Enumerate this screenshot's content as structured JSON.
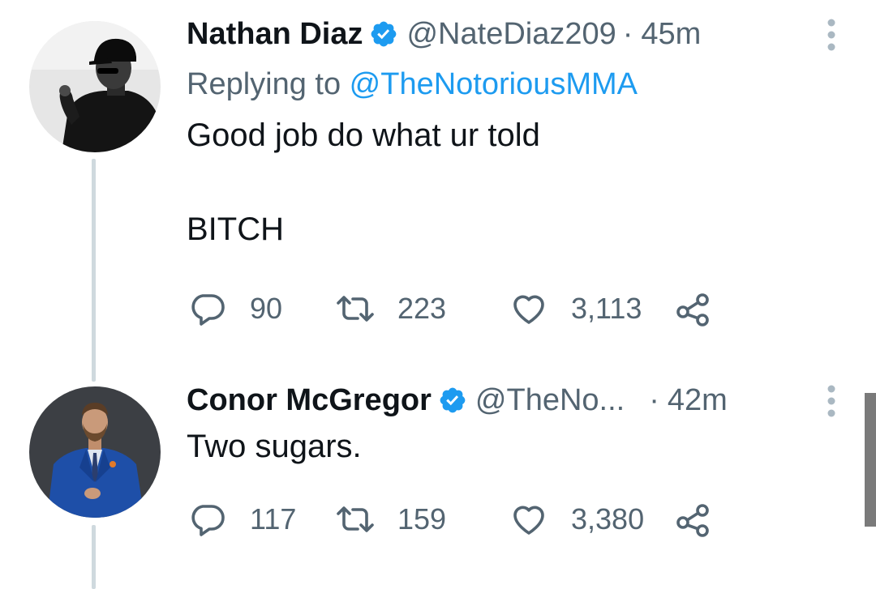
{
  "tweets": [
    {
      "name": "Nathan Diaz",
      "handle": "@NateDiaz209",
      "separator": "·",
      "time": "45m",
      "replying_prefix": "Replying to ",
      "replying_to": "@TheNotoriousMMA",
      "text": "Good job do what ur told\n\nBITCH",
      "replies": "90",
      "retweets": "223",
      "likes": "3,113"
    },
    {
      "name": "Conor McGregor",
      "handle": "@TheNo...",
      "separator": "·",
      "time": "42m",
      "text": "Two sugars.",
      "replies": "117",
      "retweets": "159",
      "likes": "3,380"
    }
  ],
  "colors": {
    "verified": "#1d9bf0",
    "mention": "#1d9bf0",
    "secondary_text": "#536471",
    "thread_line": "#cfd9de"
  },
  "icons": [
    "verified-badge-icon",
    "more-icon",
    "reply-icon",
    "retweet-icon",
    "like-icon",
    "share-icon"
  ]
}
